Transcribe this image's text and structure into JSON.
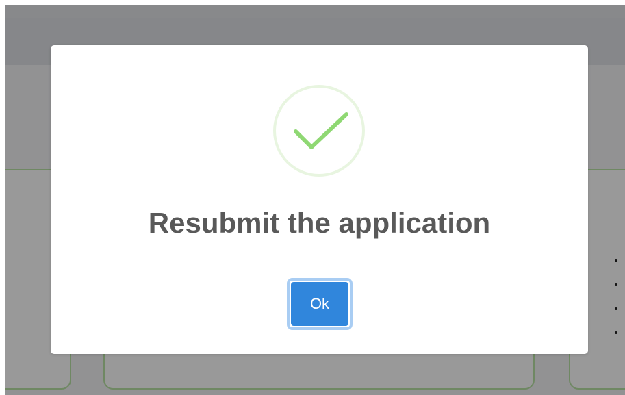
{
  "dialog": {
    "title": "Resubmit the application",
    "ok_label": "Ok",
    "icon": "success-checkmark-icon"
  },
  "colors": {
    "check": "#8fd873",
    "ok_button": "#3086dc",
    "title": "#595959",
    "card_border": "#b9e3a6"
  }
}
